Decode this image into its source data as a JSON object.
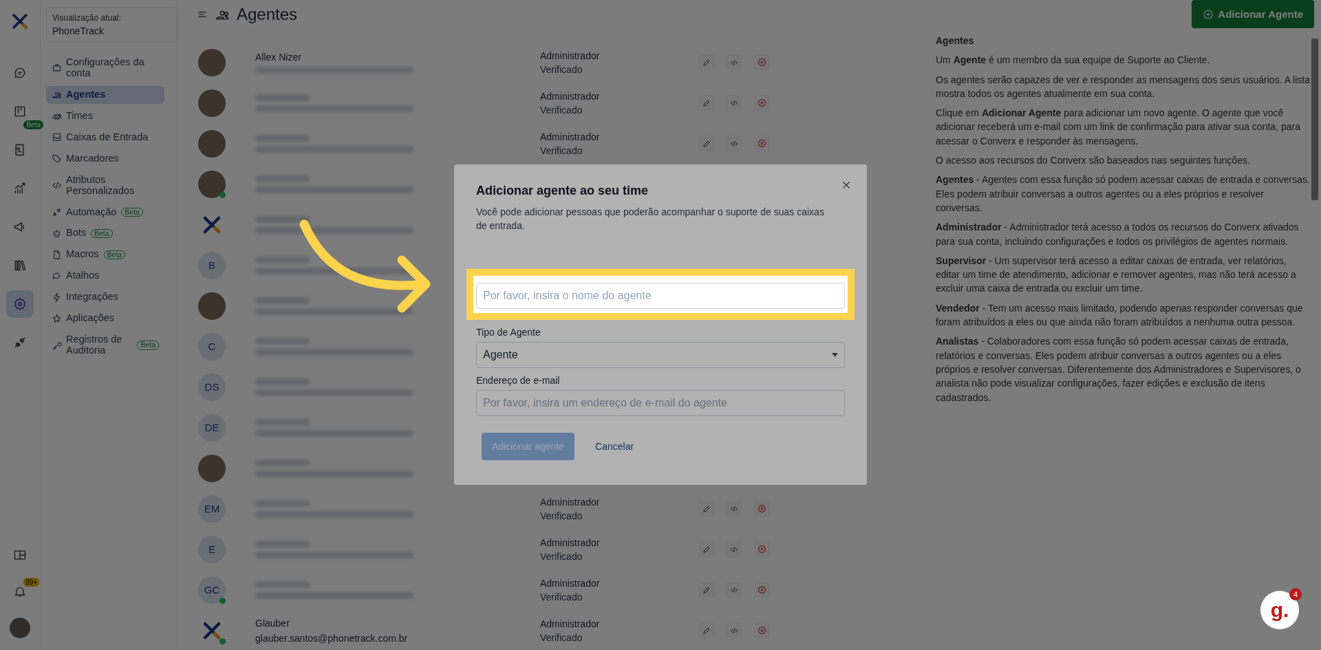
{
  "rail": {
    "items": [
      {
        "kind": "chat",
        "selected": false
      },
      {
        "kind": "kanban",
        "selected": false,
        "badge": "Beta"
      },
      {
        "kind": "contacts",
        "selected": false
      },
      {
        "kind": "reports",
        "selected": false
      },
      {
        "kind": "campaigns",
        "selected": false
      },
      {
        "kind": "library",
        "selected": false
      },
      {
        "kind": "settings",
        "selected": true
      },
      {
        "kind": "integrations",
        "selected": false
      }
    ],
    "bottom": [
      {
        "kind": "layout"
      },
      {
        "kind": "bell",
        "badge": "99+"
      },
      {
        "kind": "avatar"
      }
    ]
  },
  "sidebar": {
    "view_label": "Visualização atual:",
    "account": "PhoneTrack",
    "items": [
      {
        "label": "Configurações da conta",
        "selected": false
      },
      {
        "label": "Agentes",
        "selected": true
      },
      {
        "label": "Times",
        "selected": false
      },
      {
        "label": "Caixas de Entrada",
        "selected": false
      },
      {
        "label": "Marcadores",
        "selected": false
      },
      {
        "label": "Atributos Personalizados",
        "selected": false
      },
      {
        "label": "Automação",
        "selected": false,
        "badge": "Beta"
      },
      {
        "label": "Bots",
        "selected": false,
        "badge": "Beta"
      },
      {
        "label": "Macros",
        "selected": false,
        "badge": "Beta"
      },
      {
        "label": "Atalhos",
        "selected": false
      },
      {
        "label": "Integrações",
        "selected": false
      },
      {
        "label": "Aplicações",
        "selected": false
      },
      {
        "label": "Registros de Auditoria",
        "selected": false,
        "badge": "Beta"
      }
    ]
  },
  "header": {
    "title": "Agentes",
    "add_button": "Adicionar Agente"
  },
  "agents": [
    {
      "kind": "photo",
      "online": false,
      "name": "Allex Nizer",
      "role": "Administrador",
      "status": "Verificado"
    },
    {
      "kind": "photo",
      "online": false,
      "role": "Administrador",
      "status": "Verificado"
    },
    {
      "kind": "photo",
      "online": false,
      "role": "Administrador",
      "status": "Verificado"
    },
    {
      "kind": "photo",
      "online": true
    },
    {
      "kind": "logo",
      "online": false
    },
    {
      "kind": "initials",
      "initials": "B",
      "online": false
    },
    {
      "kind": "photo",
      "online": false
    },
    {
      "kind": "initials",
      "initials": "C",
      "online": false
    },
    {
      "kind": "initials",
      "initials": "DS",
      "online": false
    },
    {
      "kind": "initials",
      "initials": "DE",
      "online": false
    },
    {
      "kind": "photo",
      "online": false
    },
    {
      "kind": "initials",
      "initials": "EM",
      "online": false,
      "role": "Administrador",
      "status": "Verificado"
    },
    {
      "kind": "initials",
      "initials": "E",
      "online": false,
      "role": "Administrador",
      "status": "Verificado"
    },
    {
      "kind": "initials",
      "initials": "GC",
      "online": true,
      "role": "Administrador",
      "status": "Verificado"
    },
    {
      "kind": "logo",
      "online": true,
      "name": "Glauber",
      "email": "glauber.santos@phonetrack.com.br",
      "role": "Administrador",
      "status": "Verificado"
    }
  ],
  "help": {
    "title": "Agentes",
    "paragraphs": [
      "Um **Agente** é um membro da sua equipe de Suporte ao Cliente.",
      "Os agentes serão capazes de ver e responder as mensagens dos seus usuários. A lista mostra todos os agentes atualmente em sua conta.",
      "Clique em **Adicionar Agente** para adicionar um novo agente. O agente que você adicionar receberá um e-mail com um link de confirmação para ativar sua conta, para acessar o Converx e responder às mensagens.",
      "O acesso aos recursos do Converx são baseados nas seguintes funções.",
      "**Agentes** - Agentes com essa função só podem acessar caixas de entrada e conversas. Eles podem atribuir conversas a outros agentes ou a eles próprios e resolver conversas.",
      "**Administrador** - Administrador terá acesso a todos os recursos do Converx ativados para sua conta, incluindo configurações e todos os privilégios de agentes normais.",
      "**Supervisor** - Um supervisor terá acesso a editar caixas de entrada, ver relatórios, editar um time de atendimento, adicionar e remover agentes, mas não terá acesso a excluir uma caixa de entrada ou excluir um time.",
      "**Vendedor** - Tem um acesso mais limitado, podendo apenas responder conversas que foram atribuídos a eles ou que ainda não foram atribuídos a nenhuma outra pessoa.",
      "**Analistas** - Colaboradores com essa função só podem acessar caixas de entrada, relatórios e conversas. Eles podem atribuir conversas a outros agentes ou a eles próprios e resolver conversas. Diferentemente dos Administradores e Supervisores, o analista não pode visualizar configurações, fazer edições e exclusão de itens cadastrados."
    ]
  },
  "modal": {
    "title": "Adicionar agente ao seu time",
    "description": "Você pode adicionar pessoas que poderão acompanhar o suporte de suas caixas de entrada.",
    "fields": [
      {
        "kind": "text",
        "placeholder": "Por favor, insira o nome do agente",
        "highlighted": true
      },
      {
        "kind": "select",
        "label": "Tipo de Agente",
        "value": "Agente",
        "highlighted": false
      },
      {
        "kind": "text",
        "label": "Endereço de e-mail",
        "placeholder": "Por favor, insira um endereço de e-mail do agente",
        "highlighted": false
      }
    ],
    "submit": {
      "label": "Adicionar agente",
      "disabled": true
    },
    "cancel": "Cancelar"
  },
  "chat_widget": {
    "logo": "g.",
    "badge": "4"
  }
}
